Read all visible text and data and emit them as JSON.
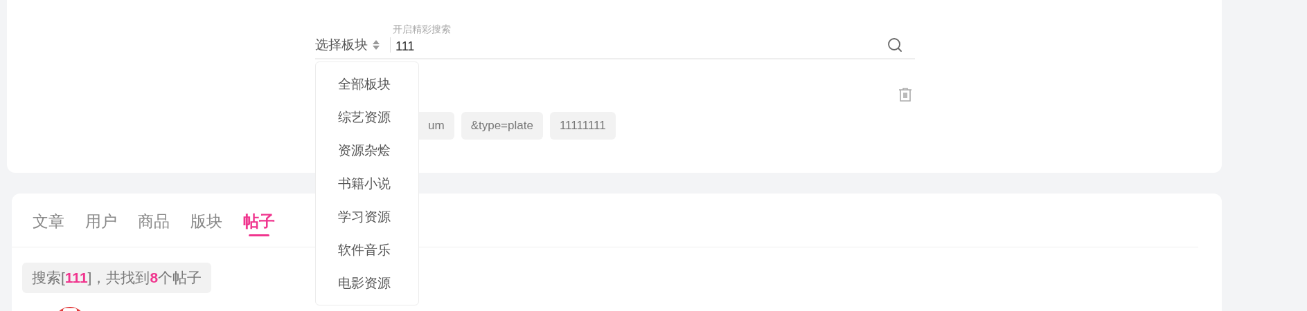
{
  "search": {
    "plate_select": "选择板块",
    "label": "开启精彩搜索",
    "value": "111"
  },
  "history": {
    "tags": [
      "um",
      "&type=plate",
      "11111111"
    ]
  },
  "plate_menu": {
    "items": [
      "全部板块",
      "综艺资源",
      "资源杂烩",
      "书籍小说",
      "学习资源",
      "软件音乐",
      "电影资源"
    ]
  },
  "tabs": [
    {
      "label": "文章",
      "selected": false
    },
    {
      "label": "用户",
      "selected": false
    },
    {
      "label": "商品",
      "selected": false
    },
    {
      "label": "版块",
      "selected": false
    },
    {
      "label": "帖子",
      "selected": true
    }
  ],
  "result_summary": "搜索[**111**]，共找到**8**个帖子"
}
